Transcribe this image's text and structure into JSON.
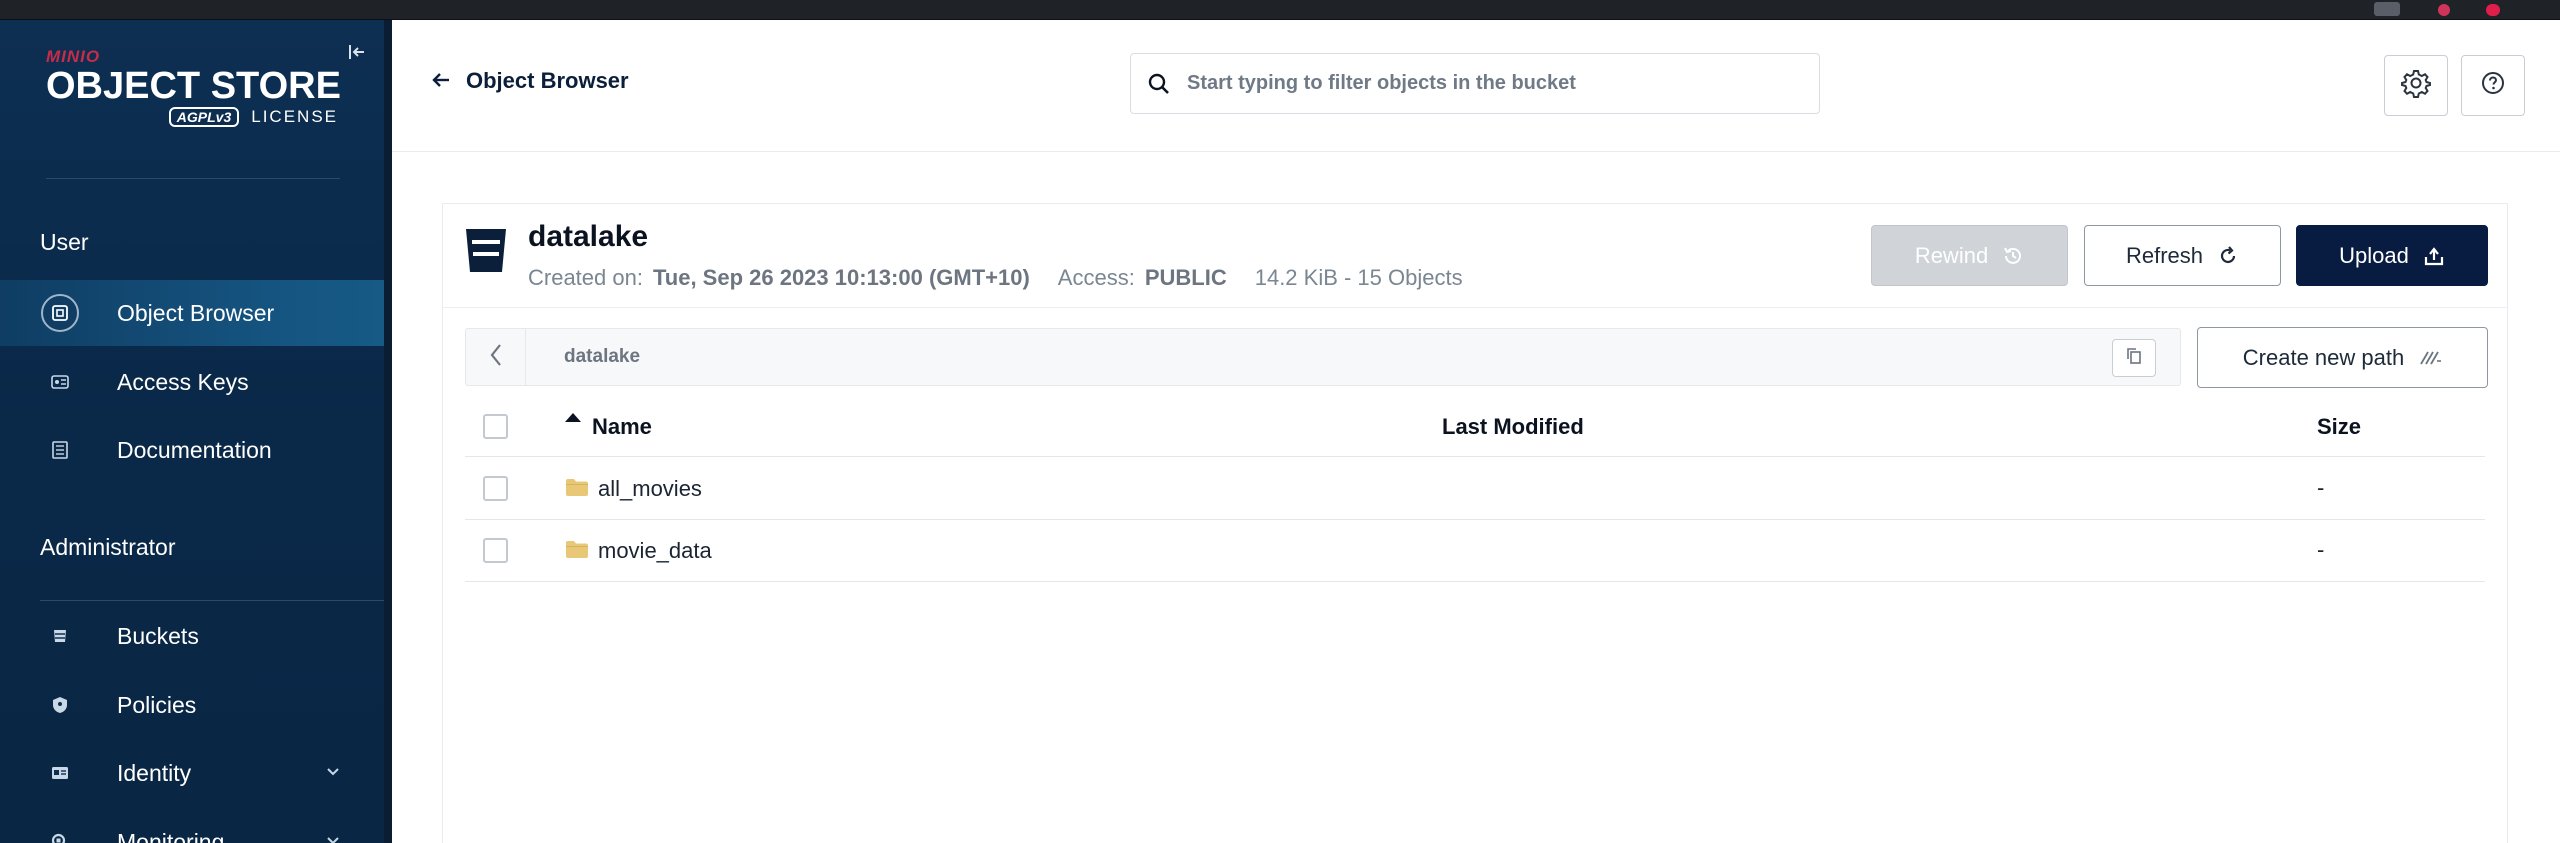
{
  "brand": {
    "logo_top": "MINIO",
    "logo_main": "OBJECT STORE",
    "logo_badge": "AGPLv3",
    "logo_license": "LICENSE"
  },
  "sidebar": {
    "user_section": "User",
    "admin_section": "Administrator",
    "user_items": [
      {
        "label": "Object Browser",
        "icon": "object-browser-icon",
        "active": true
      },
      {
        "label": "Access Keys",
        "icon": "access-keys-icon",
        "active": false
      },
      {
        "label": "Documentation",
        "icon": "documentation-icon",
        "active": false
      }
    ],
    "admin_items": [
      {
        "label": "Buckets",
        "icon": "bucket-icon",
        "expandable": false
      },
      {
        "label": "Policies",
        "icon": "shield-icon",
        "expandable": false
      },
      {
        "label": "Identity",
        "icon": "id-card-icon",
        "expandable": true
      },
      {
        "label": "Monitoring",
        "icon": "monitor-search-icon",
        "expandable": true
      }
    ]
  },
  "header": {
    "back_label": "Object Browser",
    "search_placeholder": "Start typing to filter objects in the bucket"
  },
  "bucket": {
    "name": "datalake",
    "created_label": "Created on:",
    "created_value": "Tue, Sep 26 2023 10:13:00 (GMT+10)",
    "access_label": "Access:",
    "access_value": "PUBLIC",
    "usage": "14.2 KiB - 15 Objects"
  },
  "actions": {
    "rewind": "Rewind",
    "refresh": "Refresh",
    "upload": "Upload",
    "create_path": "Create new path"
  },
  "breadcrumb": {
    "path": "datalake"
  },
  "table": {
    "columns": [
      "Name",
      "Last Modified",
      "Size"
    ],
    "rows": [
      {
        "name": "all_movies",
        "last_modified": "",
        "size": "-"
      },
      {
        "name": "movie_data",
        "last_modified": "",
        "size": "-"
      }
    ]
  },
  "colors": {
    "sidebar_bg": "#0d2f52",
    "primary_button": "#081c42",
    "folder": "#e8c877",
    "brand_red": "#c72c48"
  }
}
